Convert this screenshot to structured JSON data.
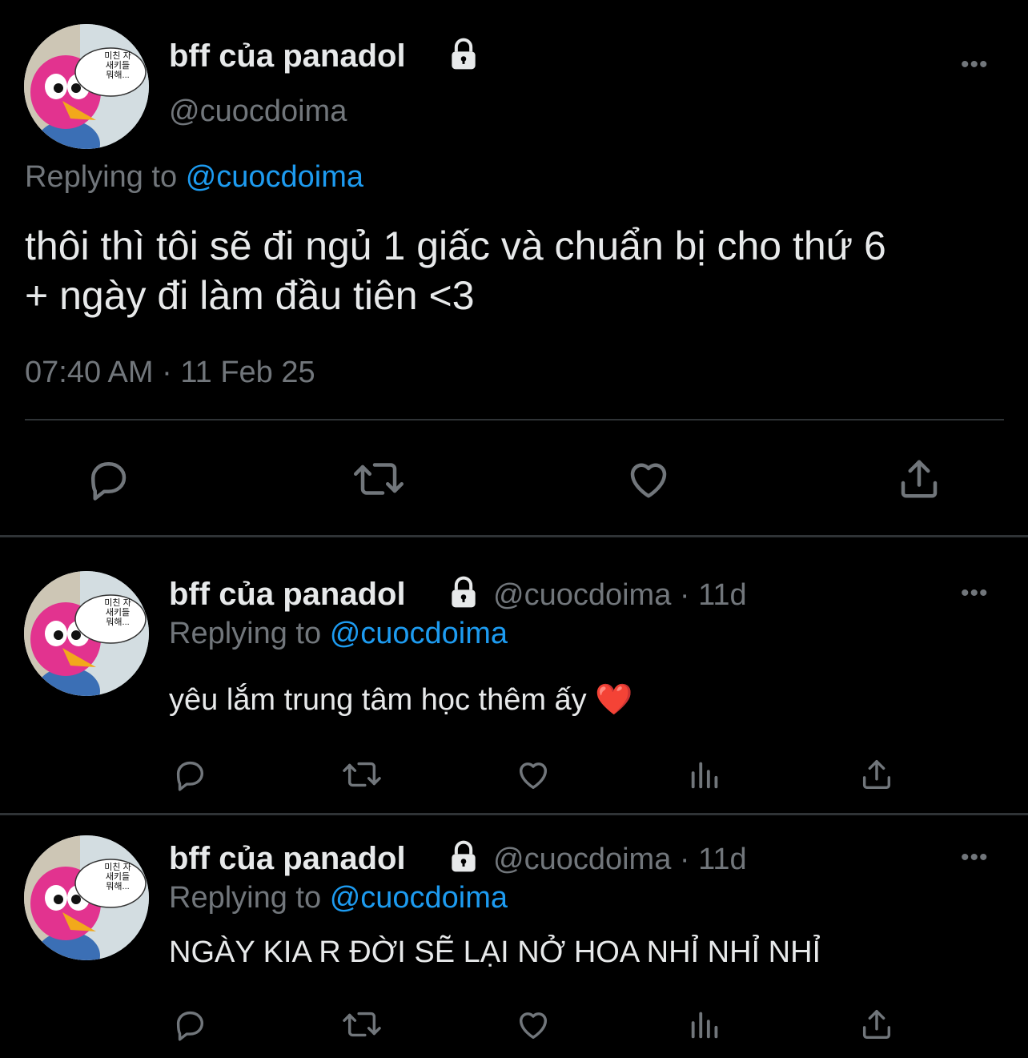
{
  "main_tweet": {
    "display_name": "bff của panadol",
    "handle": "@cuocdoima",
    "replying_prefix": "Replying to",
    "replying_handle": "@cuocdoima",
    "text_line1": "thôi thì tôi sẽ đi ngủ 1 giấc và chuẩn bị cho thứ 6",
    "text_line2": "+ ngày đi làm đầu tiên <3",
    "timestamp": "07:40 AM · 11 Feb 25",
    "icons": [
      "reply-icon",
      "retweet-icon",
      "like-icon",
      "share-icon"
    ]
  },
  "avatar": {
    "bubble_text": [
      "미친 자",
      "새키들",
      "뭐해..."
    ]
  },
  "replies": [
    {
      "display_name": "bff của panadol",
      "handle_time": "@cuocdoima · 11d",
      "replying_prefix": "Replying to",
      "replying_handle": "@cuocdoima",
      "text": "yêu lắm trung tâm học thêm ấy ❤️"
    },
    {
      "display_name": "bff của panadol",
      "handle_time": "@cuocdoima · 11d",
      "replying_prefix": "Replying to",
      "replying_handle": "@cuocdoima",
      "text": "NGÀY KIA R ĐỜI SẼ LẠI NỞ HOA NHỈ NHỈ NHỈ"
    }
  ],
  "reply_icons": [
    "reply-icon",
    "retweet-icon",
    "like-icon",
    "views-icon",
    "share-icon"
  ],
  "more_glyph": "•••",
  "colors": {
    "background": "#000000",
    "text": "#e7e9ea",
    "muted": "#71767b",
    "link": "#1d9bf0",
    "divider": "#2f3336"
  }
}
